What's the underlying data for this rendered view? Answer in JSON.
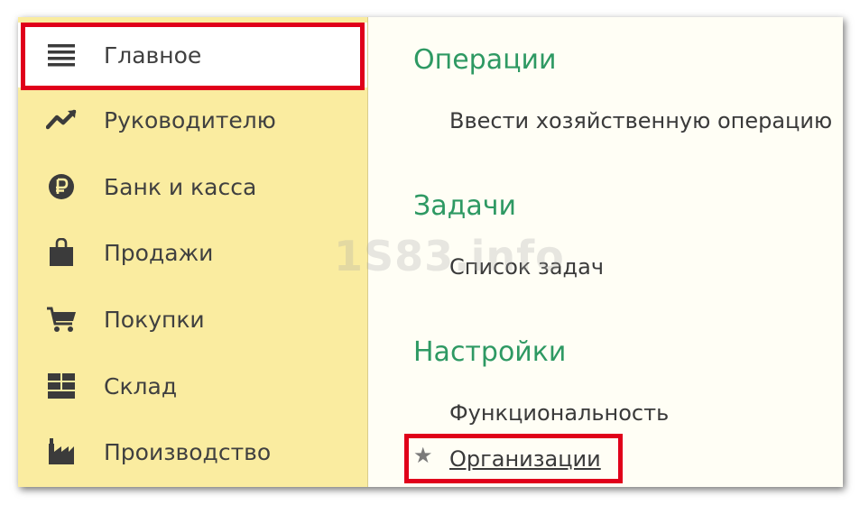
{
  "sidebar": {
    "items": [
      {
        "label": "Главное",
        "icon": "menu-icon",
        "active": true
      },
      {
        "label": "Руководителю",
        "icon": "trend-chart-icon"
      },
      {
        "label": "Банк и касса",
        "icon": "ruble-coin-icon"
      },
      {
        "label": "Продажи",
        "icon": "shopping-bag-icon"
      },
      {
        "label": "Покупки",
        "icon": "shopping-cart-icon"
      },
      {
        "label": "Склад",
        "icon": "warehouse-grid-icon"
      },
      {
        "label": "Производство",
        "icon": "factory-icon"
      }
    ]
  },
  "content": {
    "sections": [
      {
        "title": "Операции",
        "links": [
          "Ввести хозяйственную операцию"
        ]
      },
      {
        "title": "Задачи",
        "links": [
          "Список задач"
        ]
      },
      {
        "title": "Настройки",
        "links": [
          "Функциональность",
          "Организации"
        ]
      }
    ]
  },
  "watermark": "1S83.info",
  "colors": {
    "sidebar_bg": "#faeca0",
    "section_title": "#2e9963",
    "highlight": "#e0001a"
  }
}
